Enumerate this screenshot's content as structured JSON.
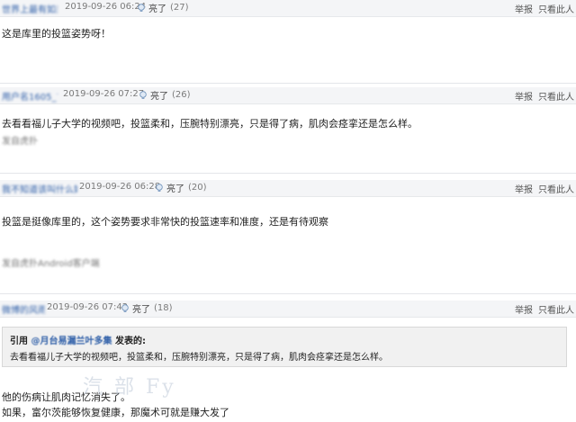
{
  "posts": [
    {
      "user": "世界上最有如果",
      "time": "2019-09-26 06:24",
      "like_label": "亮了",
      "like_count": "(27)",
      "report": "举报",
      "hide": "只看此人",
      "text": "这是库里的投篮姿势呀！",
      "blur_text": ""
    },
    {
      "user": "用户名1605_78",
      "time": "2019-09-26 07:27",
      "like_label": "亮了",
      "like_count": "(26)",
      "report": "举报",
      "hide": "只看此人",
      "text": "去看看福儿子大学的视频吧，投篮柔和，压腕特别漂亮，只是得了病，肌肉会痉挛还是怎么样。",
      "blur_text": "发自虎扑"
    },
    {
      "user": "我不知道该叫什么好",
      "time": "2019-09-26 06:28",
      "like_label": "亮了",
      "like_count": "(20)",
      "report": "举报",
      "hide": "只看此人",
      "text": "投篮是挺像库里的，这个姿势要求非常快的投篮速率和准度，还是有待观察",
      "blur_text": "发自虎扑Android客户端"
    },
    {
      "user": "微博的风雨",
      "time": "2019-09-26 07:42",
      "like_label": "亮了",
      "like_count": "(18)",
      "report": "举报",
      "hide": "只看此人",
      "quote": {
        "prefix": "引用",
        "user": "@月台易漏兰叶多集",
        "suffix": "发表的:",
        "text": "去看看福儿子大学的视频吧，投篮柔和，压腕特别漂亮，只是得了病，肌肉会痉挛还是怎么样。"
      },
      "text1": "他的伤病让肌肉记忆消失了。",
      "text2": "如果，富尔茨能够恢复健康，那魔术可就是赚大发了"
    }
  ],
  "watermark": "汽 部 Fy"
}
